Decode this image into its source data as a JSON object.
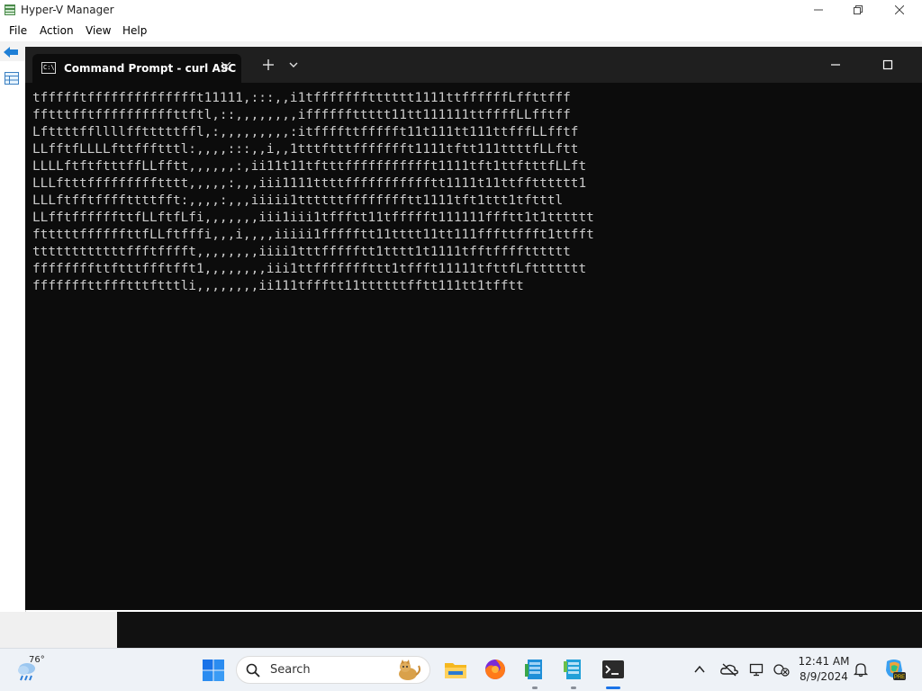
{
  "hyperv": {
    "title": "Hyper-V Manager",
    "menu": [
      "File",
      "Action",
      "View",
      "Help"
    ]
  },
  "terminal": {
    "tab_title": "Command Prompt - curl  ASC",
    "output_lines": [
      "tffffftfffffffffffffft11111,:::,,i1tffffffftttttt1111ttffffffLffttfff",
      "fftttfftffffffffffttftl,::,,,,,,,,iffffffttttt11tt111111ttffffLLfftff",
      "Lfttttffllllfftttttffl,:,,,,,,,,,:itffffttffffft11t111tt111ttfffLLfftf",
      "LLfftfLLLLfttffftttl:,,,,:::,,i,,1tttftttffffffft1111tftt111ttttfLLftt",
      "LLLLftftftttffLLfftt,,,,,,:,ii11t11tftttffffffffffft1111tft1ttftttfLLft",
      "LLLftttffffffffftttt,,,,,:,,,iii1111ttttffffffffffftt1111t11ttfftttttt1",
      "LLLftfftffffttttfft:,,,,:,,,iiiii1ttttttfffffffftt1111tft1ttt1tftttl",
      "LLfftffffffttfLLftfLfi,,,,,,,iii1iii1tffftt11tffffft111111ffftt1t1tttttt",
      "ftttttffffffttfLLftfffi,,,i,,,,iiiii1ffffftt11tttt11tt111fffttffft1ttfft",
      "ttttttttttttffftfffft,,,,,,,,iiii1tttffffftt1tttt1t1111tfftfffftttttt",
      "ffffffffttftttffftfft1,,,,,,,,iii1ttfffffffttt1tffft11111tfttfLfttttttt",
      "fffffffttffftttftttli,,,,,,,,ii111tffftt11ttttttfftt111tt1tfftt"
    ]
  },
  "taskbar": {
    "weather_temp": "76°",
    "search_label": "Search",
    "clock_time": "12:41 AM",
    "clock_date": "8/9/2024",
    "copilot_badge": "PRE"
  },
  "colors": {
    "terminal_bg": "#0c0c0c",
    "terminal_text": "#cccccc",
    "taskbar_bg": "#eef2f7",
    "accent_blue": "#1a73e8"
  }
}
